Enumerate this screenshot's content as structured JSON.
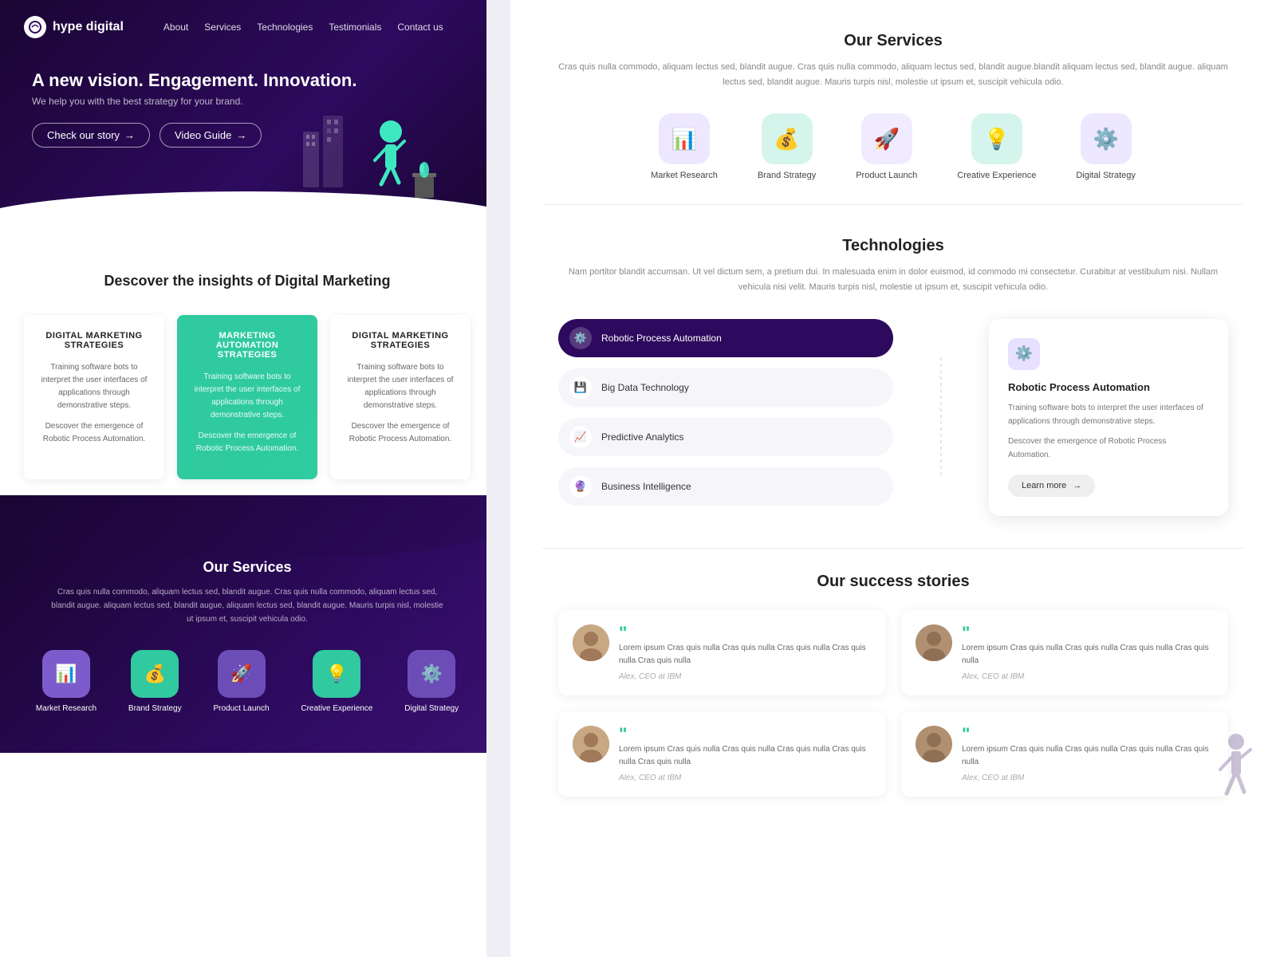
{
  "brand": {
    "name": "hype digital",
    "logo_symbol": "⊕"
  },
  "nav": {
    "links": [
      "About",
      "Services",
      "Technologies",
      "Testimonials",
      "Contact us"
    ]
  },
  "hero": {
    "title": "A new vision. Engagement. Innovation.",
    "subtitle": "We help you with the best strategy for your brand.",
    "btn1": "Check our story",
    "btn2": "Video Guide"
  },
  "insights": {
    "title": "Descover the insights of Digital Marketing",
    "cards": [
      {
        "title": "DIGITAL MARKETING STRATEGIES",
        "text1": "Training software bots to interpret the user interfaces of applications through demonstrative steps.",
        "text2": "Descover the emergence of Robotic Process Automation.",
        "active": false
      },
      {
        "title": "MARKETING AUTOMATION STRATEGIES",
        "text1": "Training software bots to interpret the user interfaces of applications through demonstrative steps.",
        "text2": "Descover the emergence of Robotic Process Automation.",
        "active": true
      },
      {
        "title": "DIGITAL MARKETING STRATEGIES",
        "text1": "Training software bots to interpret the user interfaces of applications through demonstrative steps.",
        "text2": "Descover the emergence of Robotic Process Automation.",
        "active": false
      }
    ]
  },
  "bottom_services": {
    "title": "Our Services",
    "description": "Cras quis nulla commodo, aliquam lectus sed, blandit augue. Cras quis nulla commodo, aliquam lectus sed, blandit augue.  aliquam lectus sed, blandit augue,  aliquam lectus sed, blandit augue. Mauris turpis nisl, molestie ut ipsum et, suscipit vehicula odio.",
    "items": [
      {
        "label": "Market Research",
        "color": "#7c5ccc",
        "icon": "📊"
      },
      {
        "label": "Brand Strategy",
        "color": "#30c9a0",
        "icon": "💰"
      },
      {
        "label": "Product Launch",
        "color": "#6c4db8",
        "icon": "🚀"
      },
      {
        "label": "Creative Experience",
        "color": "#30c9a0",
        "icon": "💡"
      },
      {
        "label": "Digital Strategy",
        "color": "#6c4db8",
        "icon": "⚙️"
      }
    ]
  },
  "our_services_right": {
    "title": "Our Services",
    "description": "Cras quis nulla commodo, aliquam lectus sed, blandit augue. Cras quis nulla commodo, aliquam lectus sed, blandit augue.blandit aliquam lectus sed, blandit augue.  aliquam lectus sed, blandit augue. Mauris turpis nisl, molestie ut ipsum et, suscipit vehicula odio.",
    "items": [
      {
        "label": "Market Research",
        "color": "#7c5ccc",
        "icon": "📊"
      },
      {
        "label": "Brand Strategy",
        "color": "#30c9a0",
        "icon": "💰"
      },
      {
        "label": "Product Launch",
        "color": "#7c5ccc",
        "icon": "🚀"
      },
      {
        "label": "Creative Experience",
        "color": "#30c9a0",
        "icon": "💡"
      },
      {
        "label": "Digital Strategy",
        "color": "#7c5ccc",
        "icon": "⚙️"
      }
    ]
  },
  "technologies": {
    "title": "Technologies",
    "description": "Nam portitor blandit accumsan. Ut vel dictum sem, a pretium dui. In malesuada enim in dolor euismod, id commodo mi consectetur. Curabitur at vestibulum nisi. Nullam vehicula nisi velit. Mauris turpis nisl, molestie ut ipsum et, suscipit vehicula odio.",
    "items": [
      {
        "label": "Robotic Process Automation",
        "icon": "⚙️",
        "active": true
      },
      {
        "label": "Big Data Technology",
        "icon": "💾",
        "active": false
      },
      {
        "label": "Predictive Analytics",
        "icon": "📈",
        "active": false
      },
      {
        "label": "Business Intelligence",
        "icon": "🔮",
        "active": false
      }
    ],
    "detail": {
      "icon": "⚙️",
      "title": "Robotic Process Automation",
      "text1": "Training software bots to interpret the user interfaces of applications through demonstrative steps.",
      "text2": "Descover the emergence of Robotic Process Automation.",
      "btn": "Learn more"
    }
  },
  "success_stories": {
    "title": "Our success stories",
    "stories": [
      {
        "text": "Lorem ipsum Cras quis nulla\nCras quis nulla Cras quis nulla\nCras quis nulla\nCras quis nulla",
        "author": "Alex, CEO at IBM"
      },
      {
        "text": "Lorem ipsum Cras quis nulla\nCras quis nulla Cras quis nulla\nCras quis nulla",
        "author": "Alex, CEO at IBM"
      },
      {
        "text": "Lorem ipsum Cras quis nulla\nCras quis nulla Cras quis nulla\nCras quis nulla\nCras quis nulla",
        "author": "Alex, CEO at IBM"
      },
      {
        "text": "Lorem ipsum Cras quis nulla\nCras quis nulla Cras quis nulla\nCras quis nulla",
        "author": "Alex, CEO at IBM"
      }
    ]
  }
}
